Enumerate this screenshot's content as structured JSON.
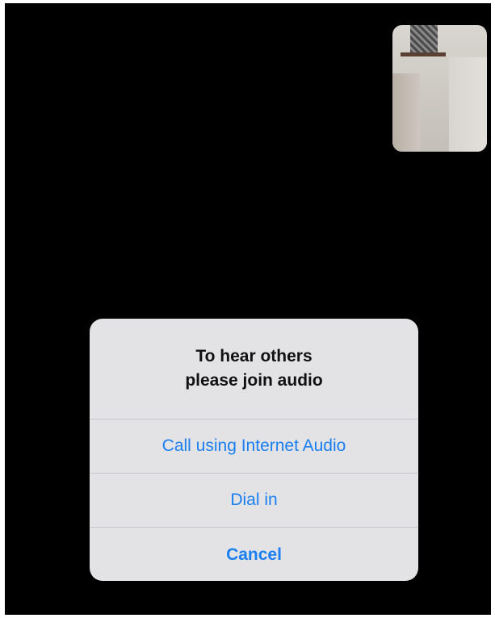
{
  "dialog": {
    "title_line1": "To hear others",
    "title_line2": "please join audio",
    "actions": [
      {
        "label": "Call using Internet Audio"
      },
      {
        "label": "Dial in"
      },
      {
        "label": "Cancel"
      }
    ]
  },
  "colors": {
    "action_blue": "#1a7ff0",
    "alert_background": "#e3e3e6",
    "screen_background": "#000000"
  }
}
